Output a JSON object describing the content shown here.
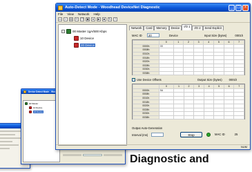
{
  "main_window": {
    "title": "Auto-Detect Mode - Woodhead DeviceNet Diagnostic",
    "menus": [
      "File",
      "View",
      "Network",
      "Help"
    ],
    "tree": {
      "root": "00 Master 1gA/500 Kbps",
      "children": [
        "10 Device",
        "20 Device"
      ]
    },
    "tabs": [
      "Network",
      "Card",
      "Memory",
      "Device",
      "I/O 1",
      "I/O 2",
      "Send Explicit"
    ],
    "active_tab": "I/O 1",
    "mac_id_label": "MAC ID",
    "mac_id_value": "20",
    "device_label": "Device",
    "input_size_label": "Input Size (bytes)",
    "input_size_value": "0001h",
    "input_grid": {
      "columns": [
        "0",
        "1",
        "2",
        "3",
        "4",
        "5",
        "6",
        "7"
      ],
      "rows": [
        {
          "label": "0000h",
          "cells": [
            "00"
          ]
        },
        {
          "label": "0008h",
          "cells": []
        },
        {
          "label": "0010h",
          "cells": []
        },
        {
          "label": "0018h",
          "cells": []
        },
        {
          "label": "0020h",
          "cells": []
        },
        {
          "label": "0028h",
          "cells": []
        },
        {
          "label": "0030h",
          "cells": []
        },
        {
          "label": "0038h",
          "cells": []
        }
      ]
    },
    "use_device_offsets_label": "Use Device Offsets",
    "output_size_label": "Output Size (bytes)",
    "output_size_value": "0001h",
    "output_grid": {
      "columns": [
        "0",
        "1",
        "2",
        "3",
        "4",
        "5",
        "6",
        "7"
      ],
      "rows": [
        {
          "label": "0000h",
          "cells": [
            "5A"
          ]
        },
        {
          "label": "0008h",
          "cells": []
        },
        {
          "label": "0010h",
          "cells": []
        },
        {
          "label": "0018h",
          "cells": []
        },
        {
          "label": "0020h",
          "cells": []
        },
        {
          "label": "0028h",
          "cells": []
        },
        {
          "label": "0030h",
          "cells": []
        },
        {
          "label": "0038h",
          "cells": []
        }
      ]
    },
    "output_auto_gen_label": "Output Auto-Generation",
    "interval_label": "Interval (ms)",
    "stop_label": "Stop",
    "mac_id_bottom_label": "MAC ID",
    "mac_id_bottom_value": "25",
    "status": "NUM"
  },
  "secondary_window": {
    "title": "Device Detect Mode - Woodhead DeviceNet Diagnostic",
    "tree": {
      "root": "00 Master",
      "children": [
        "10 Device",
        "20 Device"
      ]
    }
  },
  "caption": "Diagnostic and",
  "colors": {
    "title_bar": "#0a55d8",
    "window_face": "#ece9d8",
    "selection": "#316ac5",
    "close_button": "#e2542a"
  }
}
